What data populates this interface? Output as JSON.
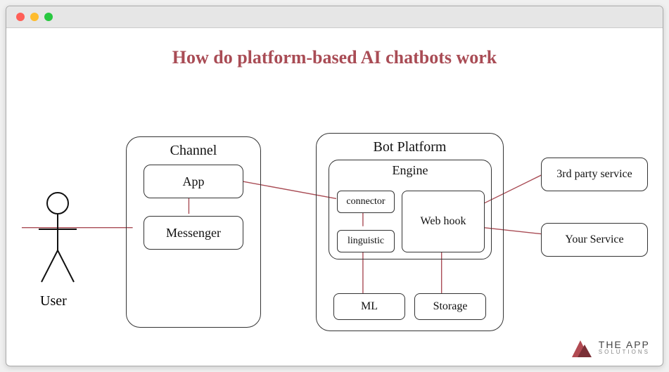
{
  "title": "How do platform-based AI chatbots work",
  "user_label": "User",
  "channel": {
    "title": "Channel",
    "app": "App",
    "messenger": "Messenger"
  },
  "platform": {
    "title": "Bot Platform",
    "engine": {
      "title": "Engine",
      "connector": "connector",
      "linguistic": "linguistic",
      "webhook": "Web hook"
    },
    "ml": "ML",
    "storage": "Storage"
  },
  "ext": {
    "third_party": "3rd party service",
    "your_service": "Your Service"
  },
  "brand": {
    "line1": "THE APP",
    "line2": "SOLUTIONS"
  },
  "colors": {
    "accent": "#a94c55"
  }
}
